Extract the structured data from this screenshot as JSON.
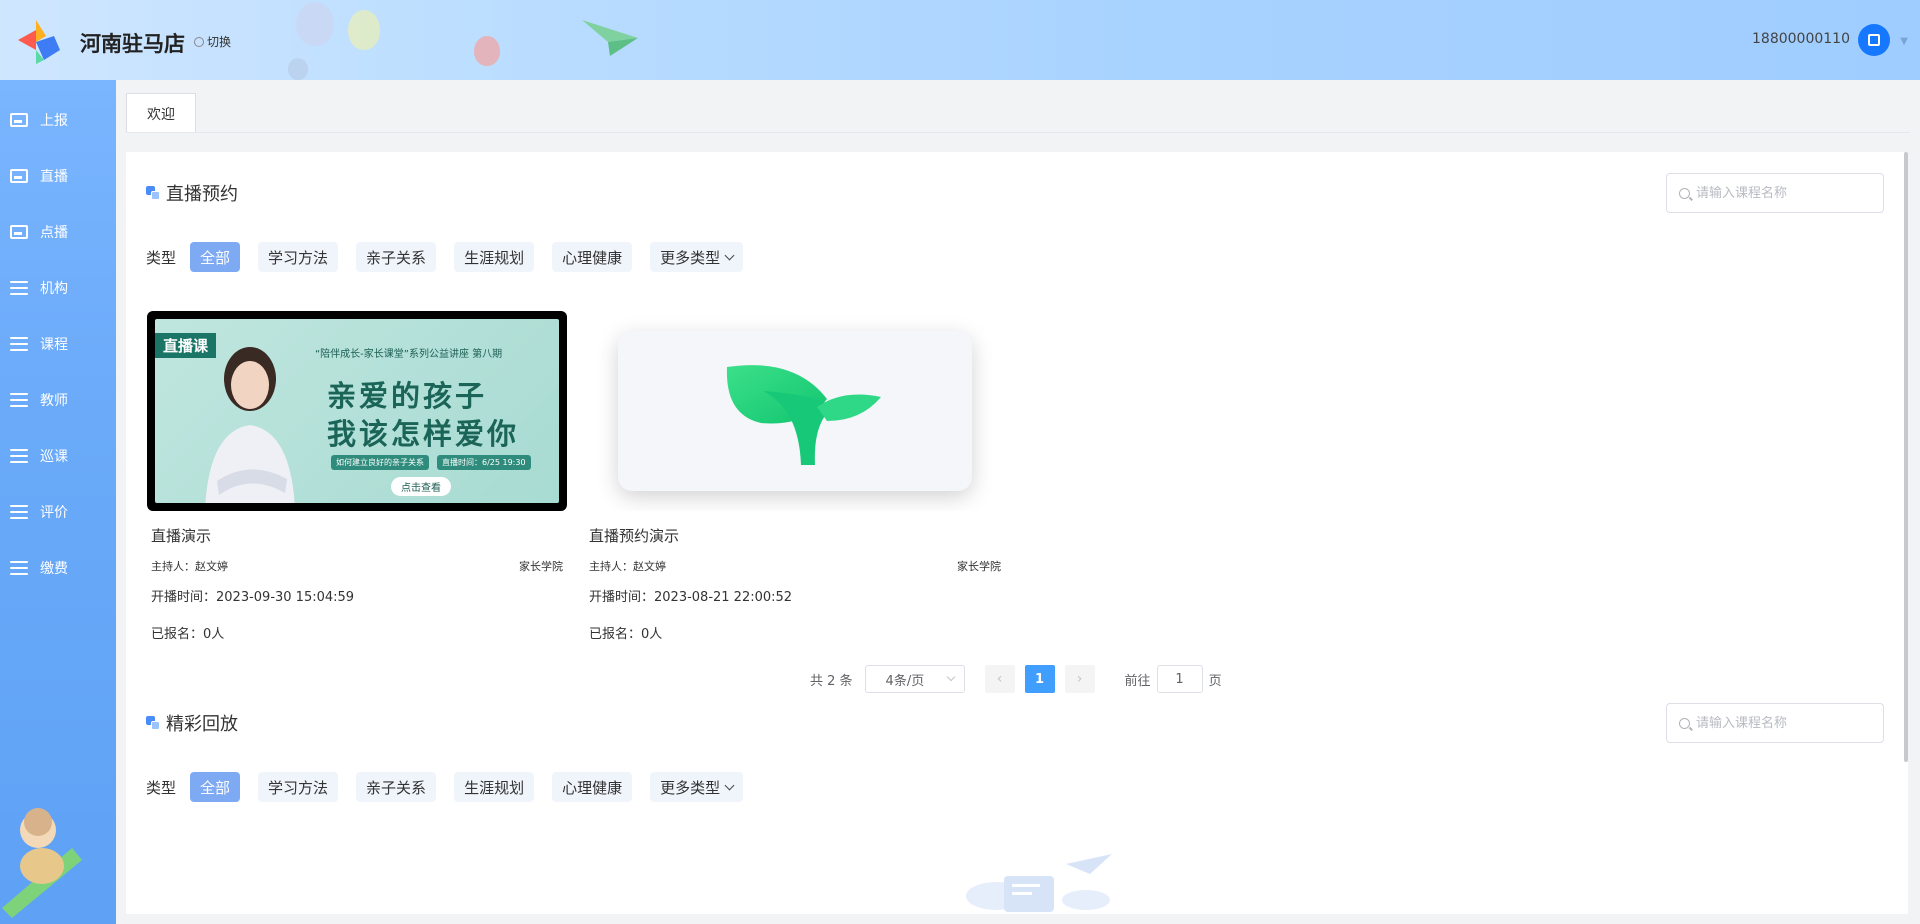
{
  "header": {
    "store_name": "河南驻马店",
    "switch_label": "切换",
    "user_phone": "18800000110"
  },
  "sidebar": {
    "items": [
      {
        "label": "上报",
        "icon": "monitor-icon"
      },
      {
        "label": "直播",
        "icon": "image-icon"
      },
      {
        "label": "点播",
        "icon": "image-icon"
      },
      {
        "label": "机构",
        "icon": "menu-icon"
      },
      {
        "label": "课程",
        "icon": "menu-icon"
      },
      {
        "label": "教师",
        "icon": "menu-icon"
      },
      {
        "label": "巡课",
        "icon": "menu-icon"
      },
      {
        "label": "评价",
        "icon": "menu-icon"
      },
      {
        "label": "缴费",
        "icon": "menu-icon"
      }
    ]
  },
  "tabs": [
    {
      "label": "欢迎"
    }
  ],
  "live_section": {
    "title": "直播预约",
    "search_placeholder": "请输入课程名称",
    "filter_label": "类型",
    "filters": [
      "全部",
      "学习方法",
      "亲子关系",
      "生涯规划",
      "心理健康",
      "更多类型"
    ],
    "active_filter": "全部",
    "cards": [
      {
        "title": "直播演示",
        "host": "主持人：赵文婷",
        "org": "家长学院",
        "start_time": "开播时间：2023-09-30 15:04:59",
        "enrolled": "已报名：0人",
        "poster": {
          "tag": "直播课",
          "subtitle": "“陪伴成长-家长课堂”系列公益讲座 第八期",
          "line1": "亲爱的孩子",
          "line2": "我该怎样爱你",
          "note1": "如何建立良好的亲子关系",
          "note2": "直播时间：6/25 19:30",
          "button": "点击查看"
        }
      },
      {
        "title": "直播预约演示",
        "host": "主持人：赵文婷",
        "org": "家长学院",
        "start_time": "开播时间：2023-08-21 22:00:52",
        "enrolled": "已报名：0人"
      }
    ],
    "pagination": {
      "total": "共 2 条",
      "page_size": "4条/页",
      "current_page": "1",
      "goto_label": "前往",
      "goto_value": "1",
      "goto_suffix": "页"
    }
  },
  "replay_section": {
    "title": "精彩回放",
    "search_placeholder": "请输入课程名称",
    "filter_label": "类型",
    "filters": [
      "全部",
      "学习方法",
      "亲子关系",
      "生涯规划",
      "心理健康",
      "更多类型"
    ],
    "active_filter": "全部"
  },
  "colors": {
    "accent": "#409eff",
    "chip_active": "#7ea9f3",
    "sidebar": "#6aaaf9"
  }
}
